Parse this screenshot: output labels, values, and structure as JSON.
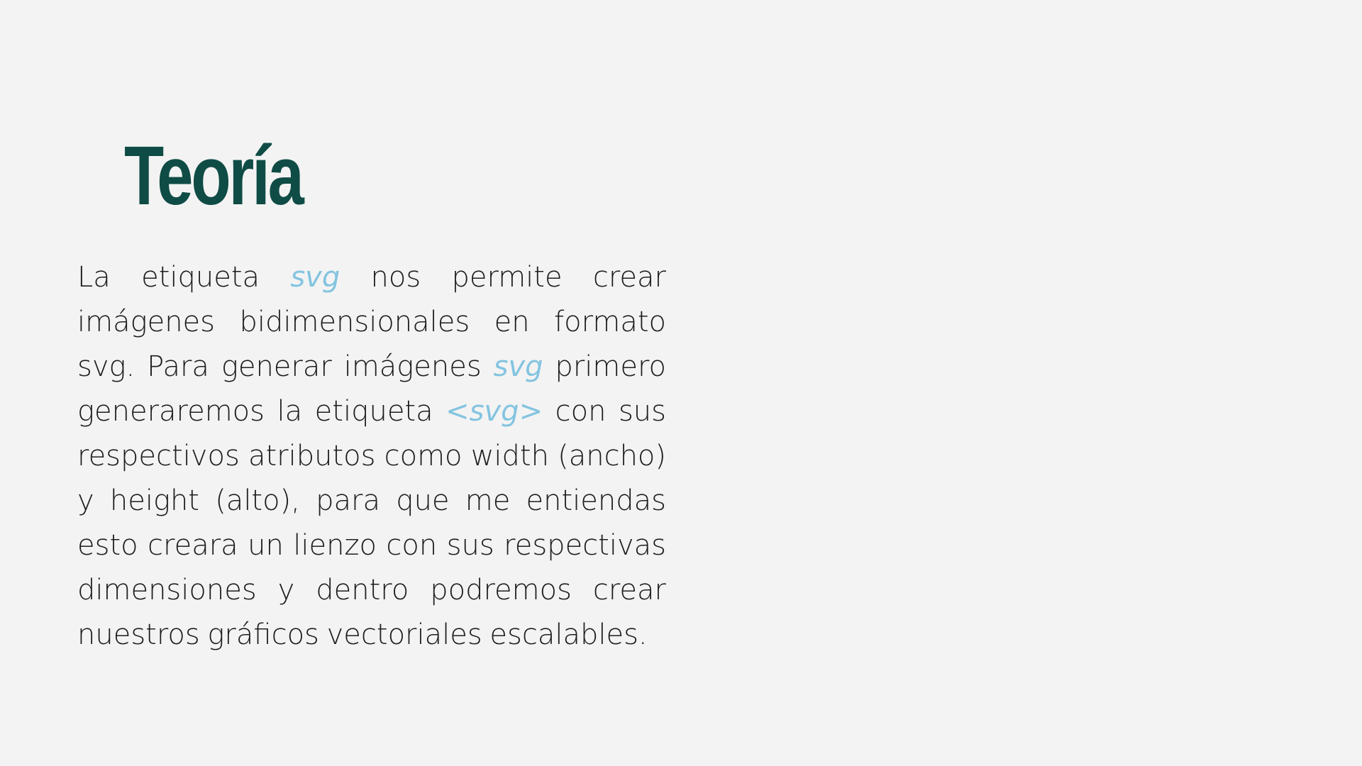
{
  "slide": {
    "title": "Teoría",
    "colors": {
      "background": "#f3f3f3",
      "title": "#0f4c45",
      "text": "#1e1e1e",
      "highlight": "#83c4e0"
    },
    "paragraph": {
      "seg1": "La etiqueta ",
      "svg1": "svg",
      "seg2": " nos permite crear imágenes bidimensionales en formato svg. Para generar imágenes ",
      "svg2": "svg",
      "seg3": " primero generaremos la etiqueta ",
      "svg3": "<svg>",
      "seg4": " con sus respectivos atributos como width (ancho) y height (alto), para que me entiendas esto creara un lienzo con sus respectivas dimensiones y dentro podremos crear nuestros gráficos vectoriales escalables."
    }
  }
}
